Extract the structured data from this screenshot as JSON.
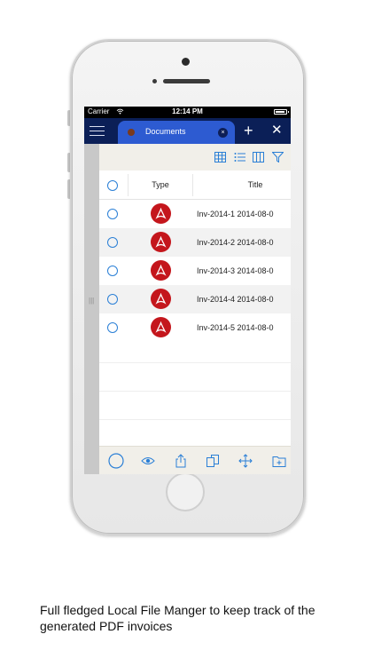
{
  "status_bar": {
    "carrier": "Carrier",
    "time": "12:14 PM",
    "battery_level": 0.95
  },
  "nav": {
    "tab_label": "Documents",
    "tab_close": "×",
    "add": "+",
    "close": "✕"
  },
  "table": {
    "headers": {
      "type": "Type",
      "title": "Title"
    },
    "rows": [
      {
        "title": "Inv-2014-1 2014-08-0"
      },
      {
        "title": "Inv-2014-2 2014-08-0"
      },
      {
        "title": "Inv-2014-3 2014-08-0"
      },
      {
        "title": "Inv-2014-4 2014-08-0"
      },
      {
        "title": "Inv-2014-5 2014-08-0"
      }
    ]
  },
  "icons": {
    "top_toolbar": [
      "grid-view-icon",
      "list-view-icon",
      "columns-view-icon",
      "filter-icon"
    ],
    "bottom_toolbar": [
      "select-circle-icon",
      "eye-icon",
      "share-icon",
      "copy-icon",
      "move-icon",
      "new-folder-icon"
    ],
    "file_type": "pdf-icon"
  },
  "colors": {
    "accent": "#2a7fd6",
    "nav_bg": "#0b1f57",
    "tab_bg": "#2d5bd1",
    "pdf_red": "#c4161c",
    "toolbar_bg": "#f1efe9"
  },
  "caption": "Full fledged Local File Manger to keep track of the generated PDF invoices"
}
